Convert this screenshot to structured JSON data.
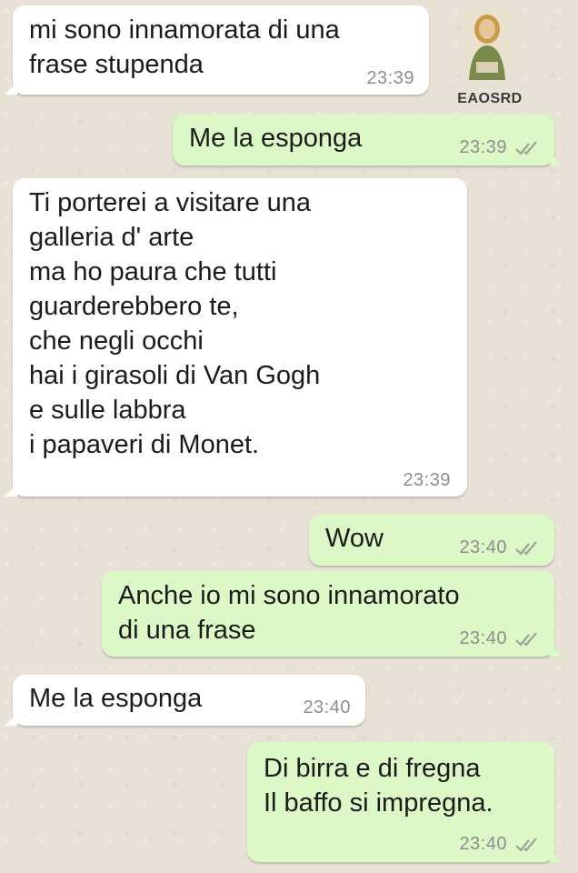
{
  "avatar": {
    "label": "EAOSRD",
    "icon": "woman-portrait-icon"
  },
  "messages": [
    {
      "direction": "in",
      "text": "mi sono innamorata di una\nfrase stupenda",
      "time": "23:39"
    },
    {
      "direction": "out",
      "text": "Me la esponga",
      "time": "23:39",
      "read_ticks": "double-check-icon"
    },
    {
      "direction": "in",
      "text": "Ti porterei a visitare una\ngalleria d' arte\nma ho paura che tutti\nguarderebbero te,\nche negli occhi\nhai i girasoli di Van Gogh\ne sulle labbra\ni papaveri di Monet.",
      "time": "23:39"
    },
    {
      "direction": "out",
      "text": "Wow",
      "time": "23:40",
      "read_ticks": "double-check-icon"
    },
    {
      "direction": "out",
      "text": "Anche io mi sono innamorato\ndi una frase",
      "time": "23:40",
      "read_ticks": "double-check-icon"
    },
    {
      "direction": "in",
      "text": "Me la esponga",
      "time": "23:40"
    },
    {
      "direction": "out",
      "text": "Di birra e di fregna\nIl baffo si impregna.",
      "time": "23:40",
      "read_ticks": "double-check-icon"
    }
  ],
  "colors": {
    "incoming": "#ffffff",
    "outgoing": "#dcf8c6",
    "background": "#e7e1d6",
    "timestamp": "#8d8d8d"
  }
}
